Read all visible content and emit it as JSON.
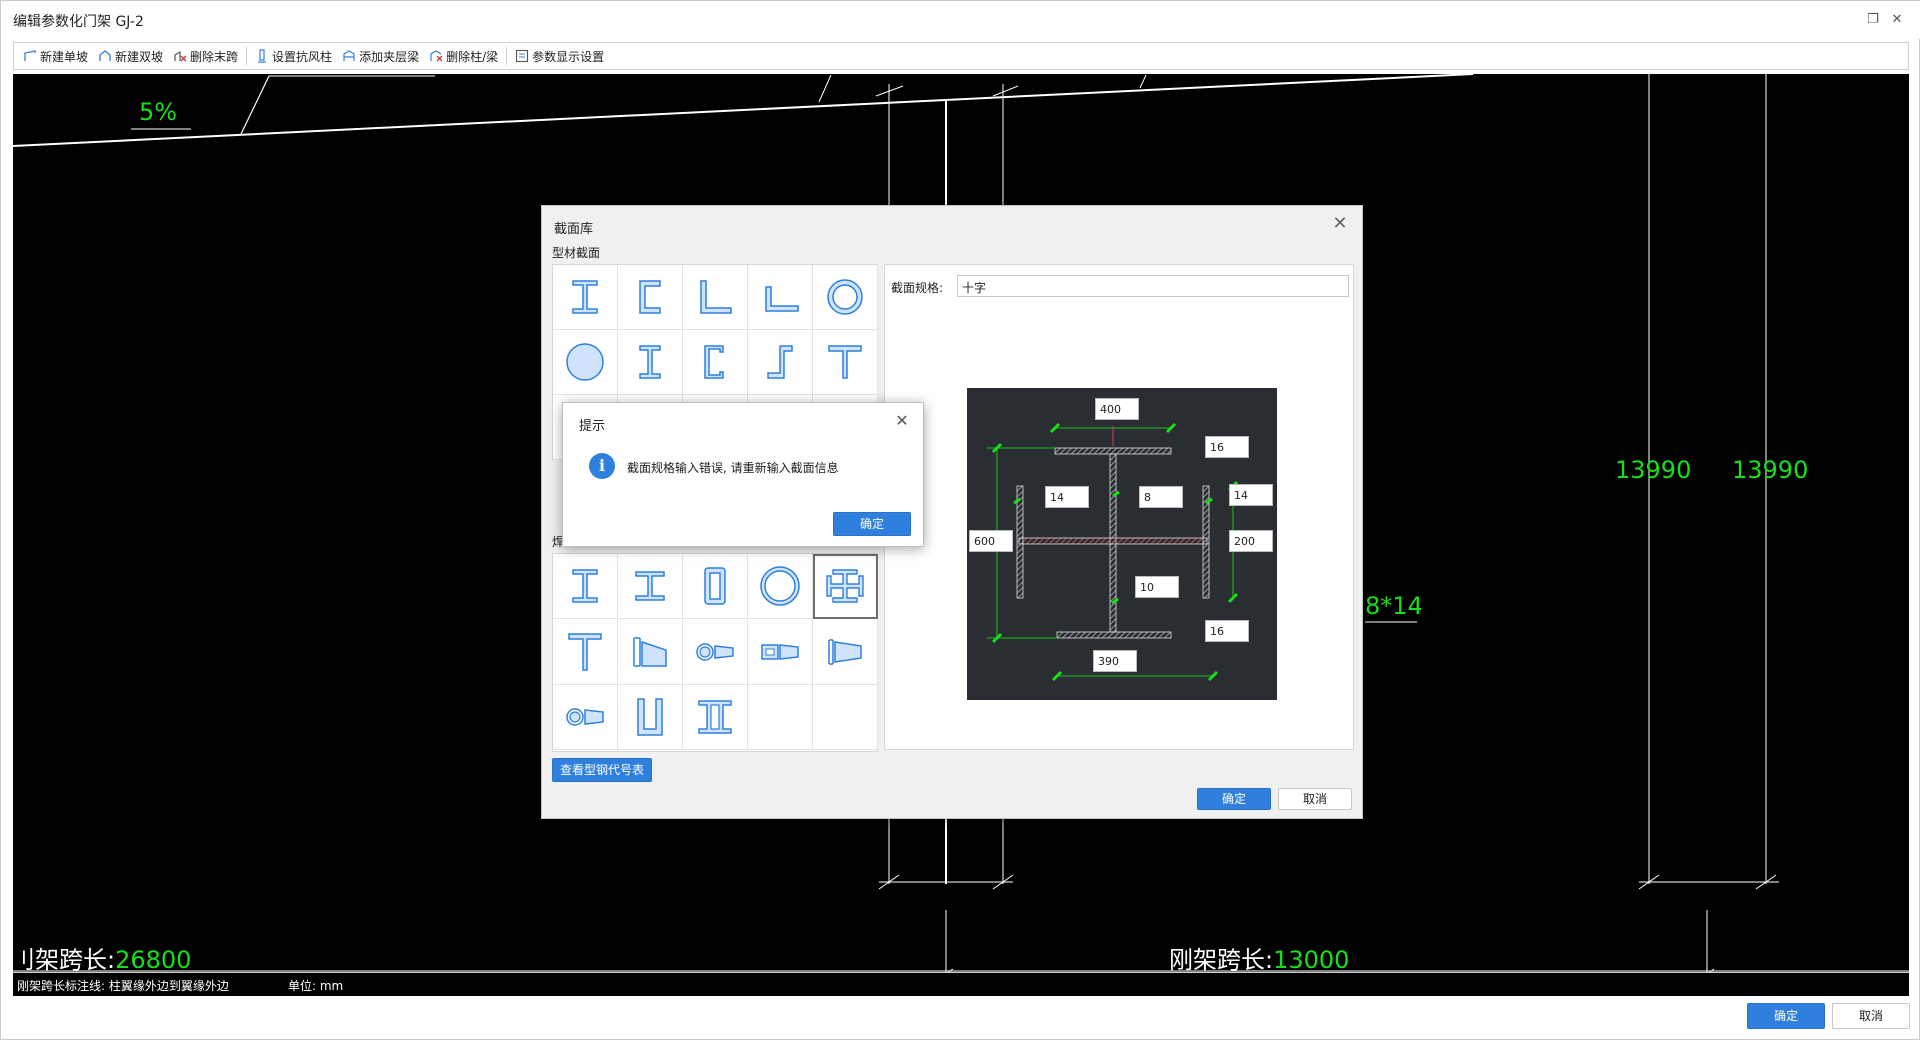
{
  "window": {
    "title": "编辑参数化门架 GJ-2"
  },
  "toolbar": {
    "items": [
      {
        "label": "新建单坡",
        "icon": "single-slope-icon"
      },
      {
        "label": "新建双坡",
        "icon": "double-slope-icon"
      },
      {
        "label": "删除末跨",
        "icon": "delete-span-icon"
      },
      {
        "label": "设置抗风柱",
        "icon": "wind-column-icon"
      },
      {
        "label": "添加夹层梁",
        "icon": "mezzanine-beam-icon"
      },
      {
        "label": "删除柱/梁",
        "icon": "delete-column-beam-icon"
      },
      {
        "label": "参数显示设置",
        "icon": "param-display-icon"
      }
    ]
  },
  "cad": {
    "slope_label": "5%",
    "dim_left_col": "13990",
    "dim_right_col": "13990",
    "section_label_partial": "8*14",
    "span_left_prefix": "刚架跨长:",
    "span_left_prefix_partial": "刂架跨长:",
    "span_left_value": "26800",
    "span_right_prefix": "刚架跨长:",
    "span_right_value": "13000",
    "colors": {
      "dimension": "#18e018",
      "lines": "#ffffff",
      "background": "#000000"
    }
  },
  "status": {
    "span_note": "刚架跨长标注线: 柱翼缘外边到翼缘外边",
    "unit": "单位: mm"
  },
  "footer": {
    "ok_label": "确定",
    "cancel_label": "取消"
  },
  "section_dialog": {
    "title": "截面库",
    "profile_group_label": "型材截面",
    "weld_group_label_partial": "焊",
    "spec_label": "截面规格:",
    "spec_value": "十字",
    "view_table_button": "查看型钢代号表",
    "ok_label": "确定",
    "cancel_label": "取消",
    "profile_icons": [
      "i-beam-icon",
      "channel-icon",
      "equal-angle-icon",
      "unequal-angle-icon",
      "pipe-icon",
      "round-bar-icon",
      "h-beam-icon",
      "lipped-channel-icon",
      "z-section-icon",
      "t-section-icon"
    ],
    "weld_icons": [
      "welded-i-icon",
      "welded-h-icon",
      "box-section-icon",
      "welded-pipe-icon",
      "cross-section-icon",
      "welded-t-icon",
      "tapered-i-icon",
      "tapered-pipe-icon",
      "tapered-box-icon",
      "tapered-flange-icon",
      "tapered-round-icon",
      "u-section-icon",
      "double-i-icon"
    ],
    "preview_dims": {
      "top_flange_width": "400",
      "top_flange_thickness": "16",
      "left_web_thickness": "14",
      "center_web_thickness": "8",
      "right_web_thickness": "14",
      "height": "600",
      "side_width": "200",
      "web_thickness": "10",
      "bottom_flange_thickness": "16",
      "bottom_flange_width": "390"
    }
  },
  "tip_dialog": {
    "title": "提示",
    "message": "截面规格输入错误, 请重新输入截面信息",
    "ok_label": "确定"
  }
}
